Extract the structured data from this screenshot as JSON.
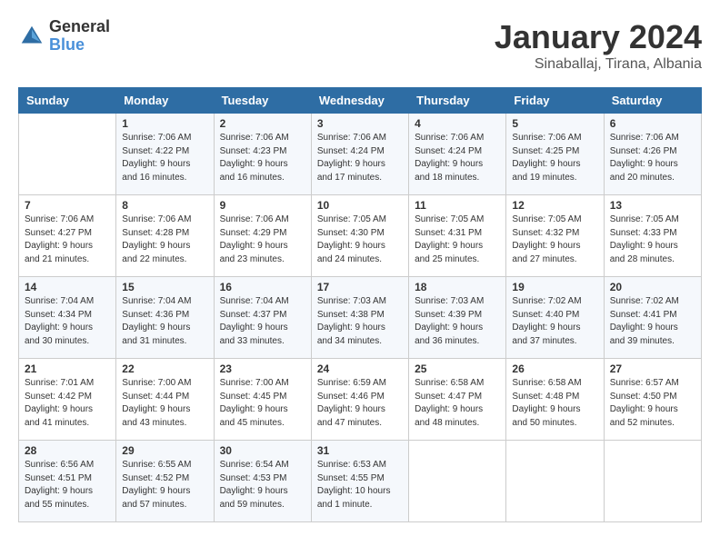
{
  "header": {
    "logo_general": "General",
    "logo_blue": "Blue",
    "month_title": "January 2024",
    "location": "Sinaballaj, Tirana, Albania"
  },
  "days_of_week": [
    "Sunday",
    "Monday",
    "Tuesday",
    "Wednesday",
    "Thursday",
    "Friday",
    "Saturday"
  ],
  "weeks": [
    [
      {
        "day": "",
        "info": ""
      },
      {
        "day": "1",
        "info": "Sunrise: 7:06 AM\nSunset: 4:22 PM\nDaylight: 9 hours\nand 16 minutes."
      },
      {
        "day": "2",
        "info": "Sunrise: 7:06 AM\nSunset: 4:23 PM\nDaylight: 9 hours\nand 16 minutes."
      },
      {
        "day": "3",
        "info": "Sunrise: 7:06 AM\nSunset: 4:24 PM\nDaylight: 9 hours\nand 17 minutes."
      },
      {
        "day": "4",
        "info": "Sunrise: 7:06 AM\nSunset: 4:24 PM\nDaylight: 9 hours\nand 18 minutes."
      },
      {
        "day": "5",
        "info": "Sunrise: 7:06 AM\nSunset: 4:25 PM\nDaylight: 9 hours\nand 19 minutes."
      },
      {
        "day": "6",
        "info": "Sunrise: 7:06 AM\nSunset: 4:26 PM\nDaylight: 9 hours\nand 20 minutes."
      }
    ],
    [
      {
        "day": "7",
        "info": "Sunrise: 7:06 AM\nSunset: 4:27 PM\nDaylight: 9 hours\nand 21 minutes."
      },
      {
        "day": "8",
        "info": "Sunrise: 7:06 AM\nSunset: 4:28 PM\nDaylight: 9 hours\nand 22 minutes."
      },
      {
        "day": "9",
        "info": "Sunrise: 7:06 AM\nSunset: 4:29 PM\nDaylight: 9 hours\nand 23 minutes."
      },
      {
        "day": "10",
        "info": "Sunrise: 7:05 AM\nSunset: 4:30 PM\nDaylight: 9 hours\nand 24 minutes."
      },
      {
        "day": "11",
        "info": "Sunrise: 7:05 AM\nSunset: 4:31 PM\nDaylight: 9 hours\nand 25 minutes."
      },
      {
        "day": "12",
        "info": "Sunrise: 7:05 AM\nSunset: 4:32 PM\nDaylight: 9 hours\nand 27 minutes."
      },
      {
        "day": "13",
        "info": "Sunrise: 7:05 AM\nSunset: 4:33 PM\nDaylight: 9 hours\nand 28 minutes."
      }
    ],
    [
      {
        "day": "14",
        "info": "Sunrise: 7:04 AM\nSunset: 4:34 PM\nDaylight: 9 hours\nand 30 minutes."
      },
      {
        "day": "15",
        "info": "Sunrise: 7:04 AM\nSunset: 4:36 PM\nDaylight: 9 hours\nand 31 minutes."
      },
      {
        "day": "16",
        "info": "Sunrise: 7:04 AM\nSunset: 4:37 PM\nDaylight: 9 hours\nand 33 minutes."
      },
      {
        "day": "17",
        "info": "Sunrise: 7:03 AM\nSunset: 4:38 PM\nDaylight: 9 hours\nand 34 minutes."
      },
      {
        "day": "18",
        "info": "Sunrise: 7:03 AM\nSunset: 4:39 PM\nDaylight: 9 hours\nand 36 minutes."
      },
      {
        "day": "19",
        "info": "Sunrise: 7:02 AM\nSunset: 4:40 PM\nDaylight: 9 hours\nand 37 minutes."
      },
      {
        "day": "20",
        "info": "Sunrise: 7:02 AM\nSunset: 4:41 PM\nDaylight: 9 hours\nand 39 minutes."
      }
    ],
    [
      {
        "day": "21",
        "info": "Sunrise: 7:01 AM\nSunset: 4:42 PM\nDaylight: 9 hours\nand 41 minutes."
      },
      {
        "day": "22",
        "info": "Sunrise: 7:00 AM\nSunset: 4:44 PM\nDaylight: 9 hours\nand 43 minutes."
      },
      {
        "day": "23",
        "info": "Sunrise: 7:00 AM\nSunset: 4:45 PM\nDaylight: 9 hours\nand 45 minutes."
      },
      {
        "day": "24",
        "info": "Sunrise: 6:59 AM\nSunset: 4:46 PM\nDaylight: 9 hours\nand 47 minutes."
      },
      {
        "day": "25",
        "info": "Sunrise: 6:58 AM\nSunset: 4:47 PM\nDaylight: 9 hours\nand 48 minutes."
      },
      {
        "day": "26",
        "info": "Sunrise: 6:58 AM\nSunset: 4:48 PM\nDaylight: 9 hours\nand 50 minutes."
      },
      {
        "day": "27",
        "info": "Sunrise: 6:57 AM\nSunset: 4:50 PM\nDaylight: 9 hours\nand 52 minutes."
      }
    ],
    [
      {
        "day": "28",
        "info": "Sunrise: 6:56 AM\nSunset: 4:51 PM\nDaylight: 9 hours\nand 55 minutes."
      },
      {
        "day": "29",
        "info": "Sunrise: 6:55 AM\nSunset: 4:52 PM\nDaylight: 9 hours\nand 57 minutes."
      },
      {
        "day": "30",
        "info": "Sunrise: 6:54 AM\nSunset: 4:53 PM\nDaylight: 9 hours\nand 59 minutes."
      },
      {
        "day": "31",
        "info": "Sunrise: 6:53 AM\nSunset: 4:55 PM\nDaylight: 10 hours\nand 1 minute."
      },
      {
        "day": "",
        "info": ""
      },
      {
        "day": "",
        "info": ""
      },
      {
        "day": "",
        "info": ""
      }
    ]
  ]
}
